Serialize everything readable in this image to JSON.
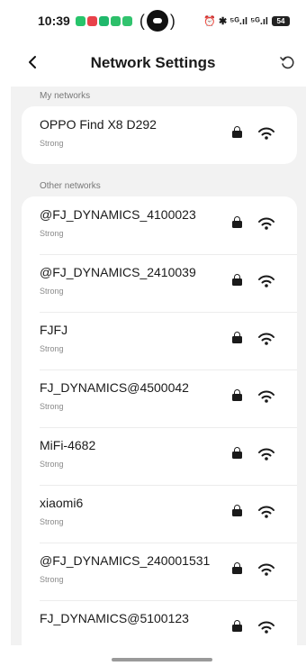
{
  "status_bar": {
    "time": "10:39",
    "notif_colors": [
      "#27c46b",
      "#e8414a",
      "#1fb86b",
      "#2dbf6a",
      "#31c36e"
    ],
    "right_text": "⏰ ✱ ⁵ᴳ.ıl ⁵ᴳ.ıl",
    "battery": "54"
  },
  "header": {
    "back_icon": "chevron-left-icon",
    "title": "Network Settings",
    "refresh_icon": "refresh-icon"
  },
  "sections": {
    "my_networks_label": "My networks",
    "other_networks_label": "Other networks"
  },
  "my_networks": [
    {
      "name": "OPPO Find X8 D292",
      "signal": "Strong"
    }
  ],
  "other_networks": [
    {
      "name": "@FJ_DYNAMICS_4100023",
      "signal": "Strong"
    },
    {
      "name": "@FJ_DYNAMICS_2410039",
      "signal": "Strong"
    },
    {
      "name": "FJFJ",
      "signal": "Strong"
    },
    {
      "name": "FJ_DYNAMICS@4500042",
      "signal": "Strong"
    },
    {
      "name": "MiFi-4682",
      "signal": "Strong"
    },
    {
      "name": "xiaomi6",
      "signal": "Strong"
    },
    {
      "name": "@FJ_DYNAMICS_240001531",
      "signal": "Strong"
    },
    {
      "name": "FJ_DYNAMICS@5100123",
      "signal": ""
    }
  ]
}
